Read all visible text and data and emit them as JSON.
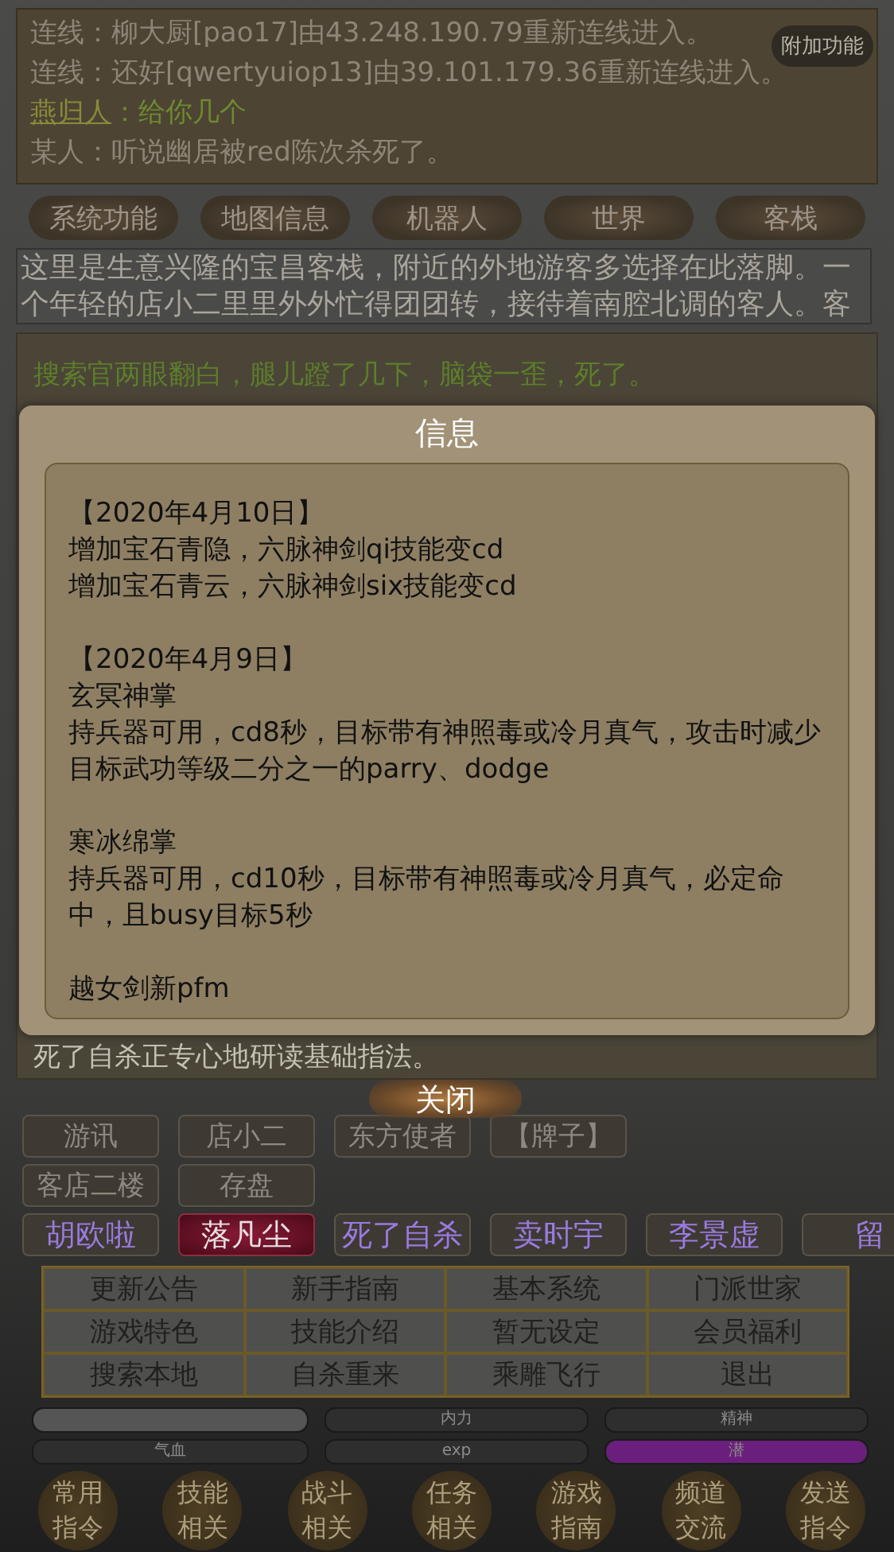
{
  "log": [
    {
      "kind": "system",
      "text": "连线：柳大厨[pao17]由43.248.190.79重新连线进入。"
    },
    {
      "kind": "system",
      "text": "连线：还好[qwertyuiop13]由39.101.179.36重新连线进入。"
    },
    {
      "kind": "chat",
      "name": "燕归人",
      "text": "：给你几个"
    },
    {
      "kind": "system",
      "text": "某人：听说幽居被red陈次杀死了。"
    }
  ],
  "extra_button": "附加功能",
  "tabs": [
    "系统功能",
    "地图信息",
    "机器人",
    "世界",
    "客栈"
  ],
  "room_description": "这里是生意兴隆的宝昌客栈，附近的外地游客多选择在此落脚。一个年轻的店小二里里外外忙得团团转，接待着南腔北调的客人。客",
  "combat_log": [
    {
      "kind": "event",
      "text": "搜索官两眼翻白，腿儿蹬了几下，脑袋一歪，死了。"
    },
    {
      "kind": "normal",
      "text": "死了自杀正专心地研读基础指法。"
    }
  ],
  "dialog": {
    "title": "信息",
    "paragraphs": [
      [
        "【2020年4月10日】",
        "增加宝石青隐，六脉神剑qi技能变cd",
        "增加宝石青云，六脉神剑six技能变cd"
      ],
      [
        "【2020年4月9日】",
        "玄冥神掌",
        "持兵器可用，cd8秒，目标带有神照毒或冷月真气，攻击时减少目标武功等级二分之一的parry、dodge"
      ],
      [
        "寒冰绵掌",
        "持兵器可用，cd10秒，目标带有神照毒或冷月真气，必定命中，且busy目标5秒"
      ],
      [
        "越女剑新pfm"
      ]
    ],
    "close": "关闭"
  },
  "action_rows": [
    [
      "游讯",
      "店小二",
      "东方使者",
      "【牌子】"
    ],
    [
      "客店二楼",
      "存盘"
    ]
  ],
  "players": [
    {
      "name": "胡欧啦",
      "selected": false
    },
    {
      "name": "落凡尘",
      "selected": true
    },
    {
      "name": "死了自杀",
      "selected": false
    },
    {
      "name": "卖时宇",
      "selected": false
    },
    {
      "name": "李景虚",
      "selected": false
    },
    {
      "name": "留",
      "selected": false
    }
  ],
  "menu": [
    [
      "更新公告",
      "新手指南",
      "基本系统",
      "门派世家"
    ],
    [
      "游戏特色",
      "技能介绍",
      "暂无设定",
      "会员福利"
    ],
    [
      "搜索本地",
      "自杀重来",
      "乘雕飞行",
      "退出"
    ]
  ],
  "bars": [
    {
      "level": 1,
      "color": "#555555"
    },
    {
      "label": "内力",
      "level": 0
    },
    {
      "label": "精神",
      "level": 0
    },
    {
      "label": "气血",
      "level": 0
    },
    {
      "label": "exp",
      "level": 0
    },
    {
      "label": "潜",
      "level": 1,
      "color": "#6b1f7c"
    }
  ],
  "commands": [
    "常用指令",
    "技能相关",
    "战斗相关",
    "任务相关",
    "游戏指南",
    "频道交流",
    "发送指令"
  ]
}
